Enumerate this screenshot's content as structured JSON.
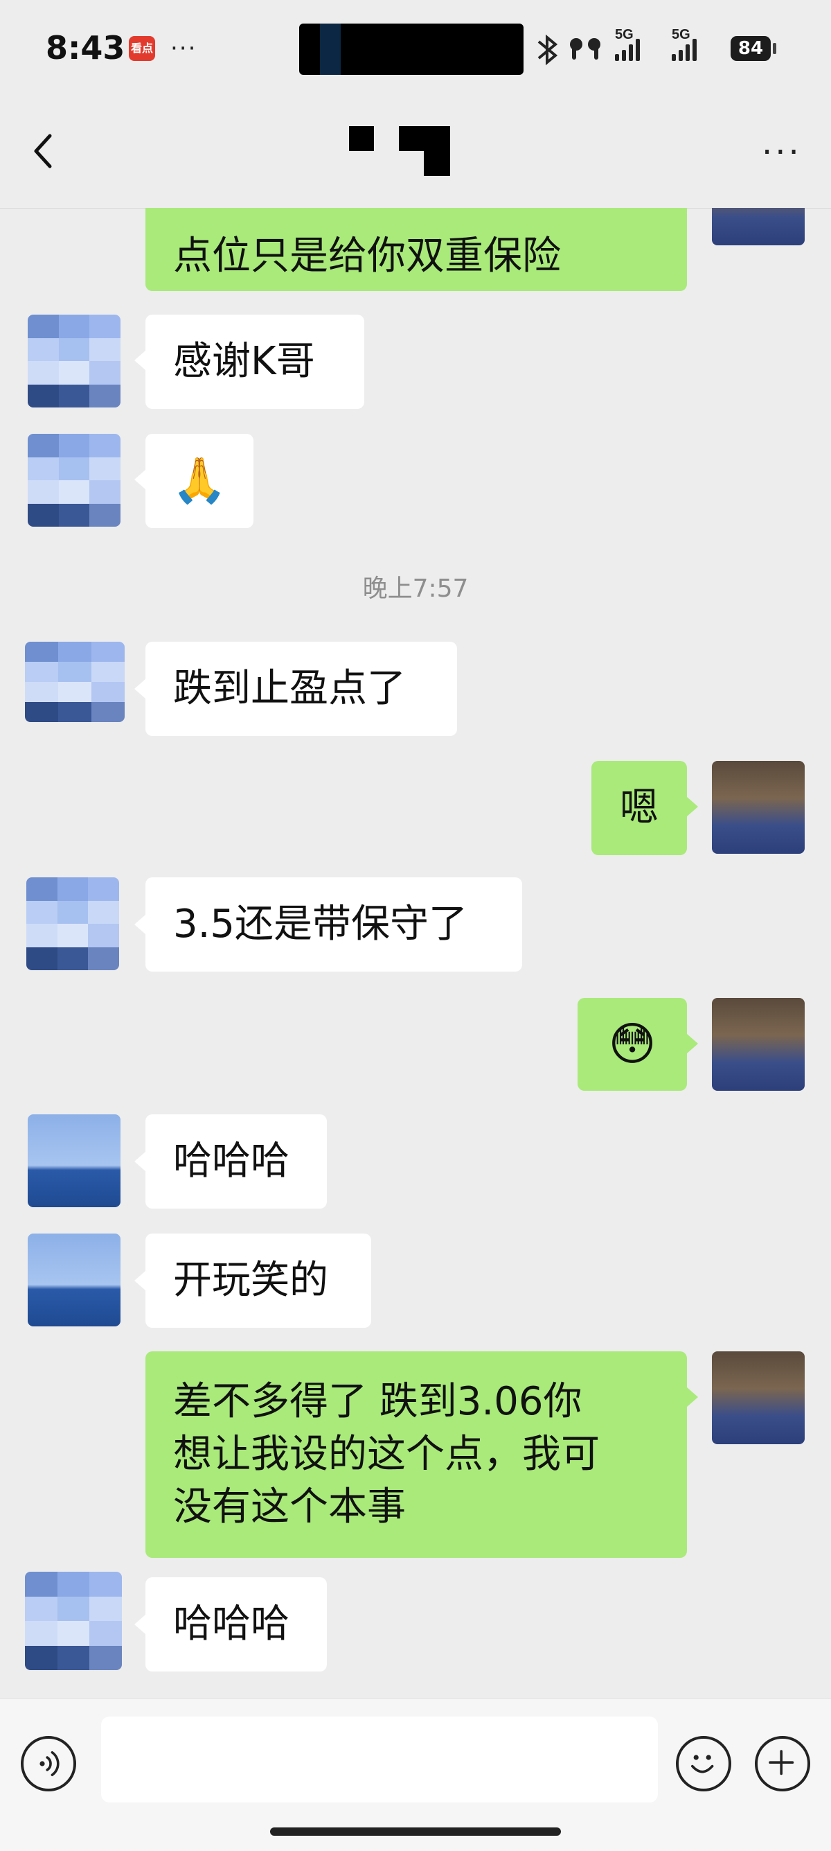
{
  "status_bar": {
    "time": "8:43",
    "app_badge": "看点",
    "more": "···",
    "battery": "84",
    "network_1": "5G",
    "network_2": "5G"
  },
  "header": {
    "back_icon": "chevron-left-icon",
    "more_icon": "more-dots-icon"
  },
  "colors": {
    "background": "#ededed",
    "incoming_bubble": "#ffffff",
    "outgoing_bubble": "#a9ea7a"
  },
  "messages": [
    {
      "side": "out",
      "type": "text",
      "text": "点位只是给你双重保险"
    },
    {
      "side": "in",
      "type": "text",
      "text": "感谢K哥"
    },
    {
      "side": "in",
      "type": "emoji",
      "text": "🙏"
    },
    {
      "type": "timestamp",
      "text": "晚上7:57"
    },
    {
      "side": "in",
      "type": "text",
      "text": "跌到止盈点了"
    },
    {
      "side": "out",
      "type": "text",
      "text": "嗯"
    },
    {
      "side": "in",
      "type": "text",
      "text": "3.5还是带保守了"
    },
    {
      "side": "out",
      "type": "emoji",
      "text": "😳"
    },
    {
      "side": "in",
      "type": "text",
      "text": "哈哈哈"
    },
    {
      "side": "in",
      "type": "text",
      "text": "开玩笑的"
    },
    {
      "side": "out",
      "type": "text",
      "lines": [
        "差不多得了 跌到3.06你",
        "想让我设的这个点，我可",
        "没有这个本事"
      ]
    },
    {
      "side": "in",
      "type": "text",
      "text": "哈哈哈"
    }
  ],
  "input_bar": {
    "voice_icon": "voice-icon",
    "emoji_icon": "smiley-icon",
    "plus_icon": "plus-icon",
    "placeholder": ""
  }
}
